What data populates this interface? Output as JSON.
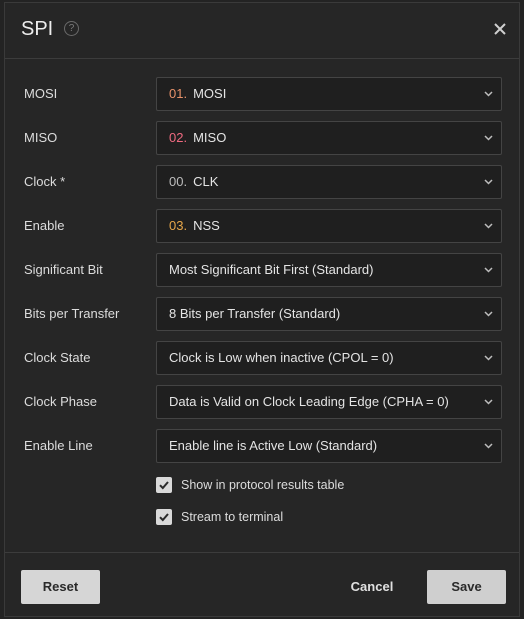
{
  "dialog": {
    "title": "SPI",
    "help_icon": "help-circle-icon",
    "close_icon": "close-icon"
  },
  "fields": [
    {
      "label": "MOSI",
      "num": "01.",
      "num_color": "#e8926a",
      "value": "MOSI"
    },
    {
      "label": "MISO",
      "num": "02.",
      "num_color": "#f06a80",
      "value": "MISO"
    },
    {
      "label": "Clock *",
      "num": "00.",
      "num_color": "#bdbdbd",
      "value": "CLK"
    },
    {
      "label": "Enable",
      "num": "03.",
      "num_color": "#e6a74a",
      "value": "NSS"
    },
    {
      "label": "Significant Bit",
      "num": "",
      "num_color": "",
      "value": "Most Significant Bit First (Standard)"
    },
    {
      "label": "Bits per Transfer",
      "num": "",
      "num_color": "",
      "value": "8 Bits per Transfer (Standard)"
    },
    {
      "label": "Clock State",
      "num": "",
      "num_color": "",
      "value": "Clock is Low when inactive (CPOL = 0)"
    },
    {
      "label": "Clock Phase",
      "num": "",
      "num_color": "",
      "value": "Data is Valid on Clock Leading Edge (CPHA = 0)"
    },
    {
      "label": "Enable Line",
      "num": "",
      "num_color": "",
      "value": "Enable line is Active Low (Standard)"
    }
  ],
  "checkboxes": [
    {
      "label": "Show in protocol results table",
      "checked": true
    },
    {
      "label": "Stream to terminal",
      "checked": true
    }
  ],
  "footer": {
    "reset_label": "Reset",
    "cancel_label": "Cancel",
    "save_label": "Save"
  }
}
